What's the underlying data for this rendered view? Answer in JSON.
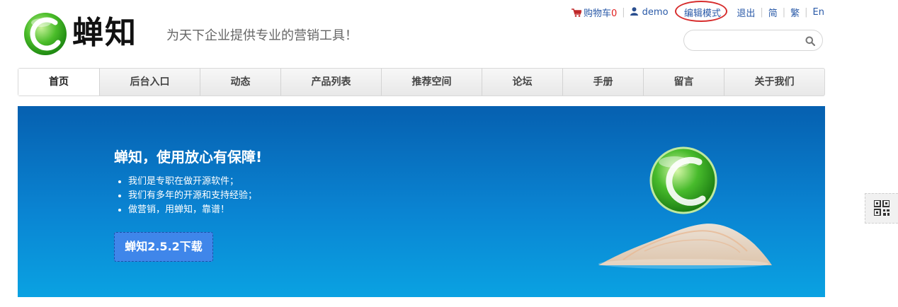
{
  "header": {
    "logo_text": "蝉知",
    "slogan": "为天下企业提供专业的营销工具！",
    "topbar": {
      "cart_label": "购物车",
      "cart_count": "0",
      "user": "demo",
      "edit_mode": "编辑模式",
      "logout": "退出",
      "simplified": "简",
      "traditional": "繁",
      "english": "En"
    },
    "search": {
      "value": "",
      "placeholder": ""
    }
  },
  "nav": {
    "items": [
      {
        "label": "首页",
        "active": true
      },
      {
        "label": "后台入口"
      },
      {
        "label": "动态"
      },
      {
        "label": "产品列表"
      },
      {
        "label": "推荐空间"
      },
      {
        "label": "论坛"
      },
      {
        "label": "手册"
      },
      {
        "label": "留言"
      },
      {
        "label": "关于我们"
      }
    ]
  },
  "banner": {
    "title": "蝉知，使用放心有保障!",
    "bullets": [
      "我们是专职在做开源软件；",
      "我们有多年的开源和支持经验；",
      "做营销，用蝉知，靠谱！"
    ],
    "button": "蝉知2.5.2下载"
  },
  "icons": {
    "cart": "cart-icon",
    "user": "user-icon",
    "search": "search-icon",
    "qr": "qr-code-icon"
  },
  "colors": {
    "accent_blue": "#2a5aa8",
    "banner_top": "#0660b0",
    "banner_bottom": "#0aa2e2",
    "button": "#3f86ea",
    "cart_red": "#e02020",
    "highlight_circle": "#d72d2d"
  }
}
